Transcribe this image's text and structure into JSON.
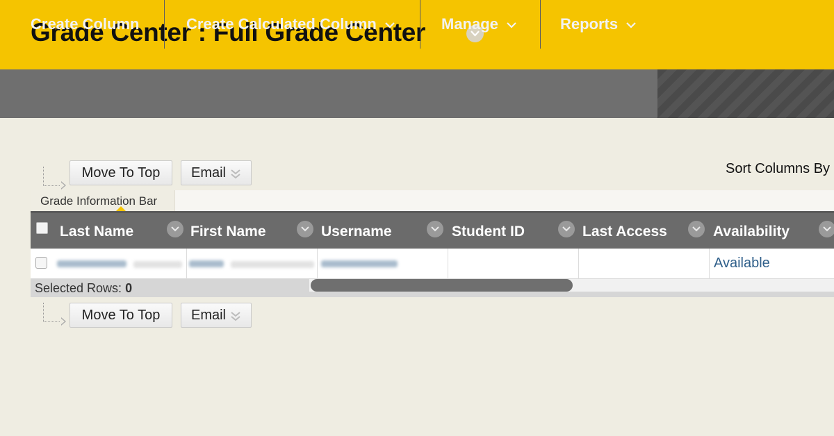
{
  "header": {
    "title": "Grade Center : Full Grade Center",
    "title_menu_icon": "chevron-down-circle-icon",
    "background": "#f5c400"
  },
  "action_bar": {
    "items": [
      {
        "label": "Create Column",
        "has_menu": false
      },
      {
        "label": "Create Calculated Column",
        "has_menu": true
      },
      {
        "label": "Manage",
        "has_menu": true
      },
      {
        "label": "Reports",
        "has_menu": true
      }
    ]
  },
  "top_controls": {
    "move_to_top": "Move To Top",
    "email": "Email"
  },
  "bottom_controls": {
    "move_to_top": "Move To Top",
    "email": "Email"
  },
  "sort": {
    "label": "Sort Columns By"
  },
  "info_bar": {
    "label": "Grade Information Bar"
  },
  "grid": {
    "columns": [
      {
        "label": "Last Name"
      },
      {
        "label": "First Name"
      },
      {
        "label": "Username"
      },
      {
        "label": "Student ID"
      },
      {
        "label": "Last Access"
      },
      {
        "label": "Availability"
      }
    ],
    "rows": [
      {
        "last_name": "",
        "first_name": "",
        "username": "",
        "student_id": "",
        "last_access": "",
        "availability": "Available"
      }
    ]
  },
  "footer": {
    "selected_label": "Selected Rows:",
    "selected_count": "0"
  },
  "colors": {
    "accent": "#f5c400",
    "toolbar": "#6f6f6f",
    "link": "#2f5f8a"
  }
}
